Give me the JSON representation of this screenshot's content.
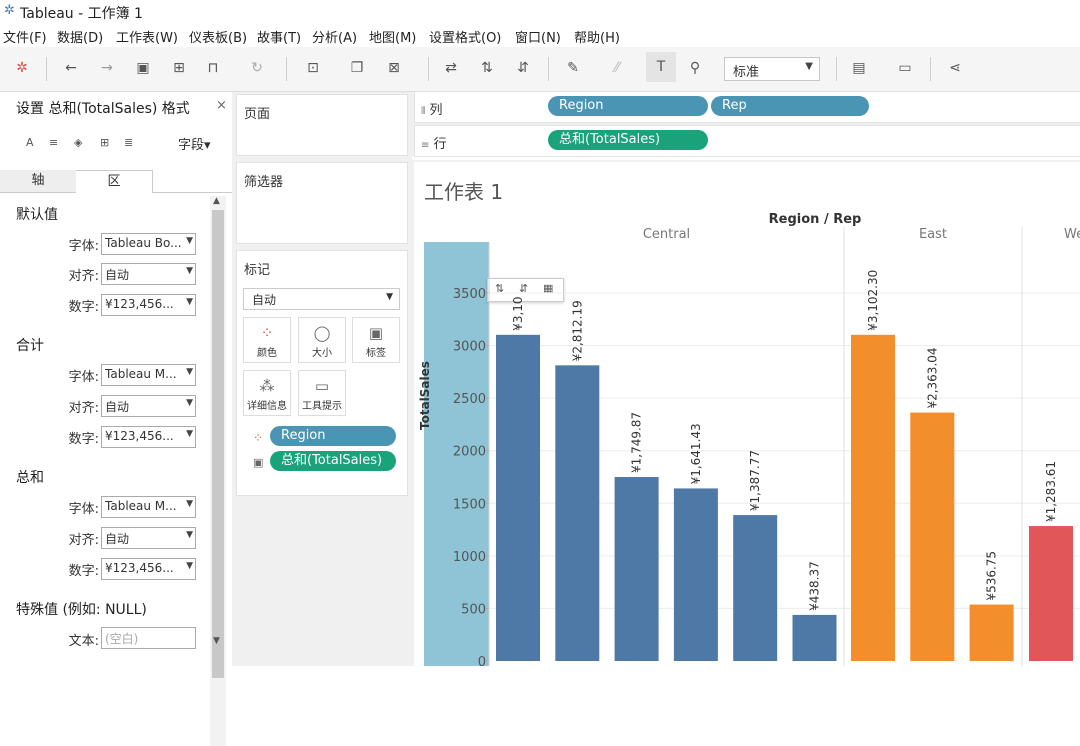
{
  "window": {
    "title": "Tableau - 工作簿 1"
  },
  "menu": [
    "文件(F)",
    "数据(D)",
    "工作表(W)",
    "仪表板(B)",
    "故事(T)",
    "分析(A)",
    "地图(M)",
    "设置格式(O)",
    "窗口(N)",
    "帮助(H)"
  ],
  "toolbar": {
    "fit_select": "标准"
  },
  "format_pane": {
    "title": "设置 总和(TotalSales) 格式",
    "close": "×",
    "fields_button": "字段▾",
    "tabs": {
      "axis": "轴",
      "area": "区"
    },
    "sections": [
      {
        "heading": "默认值",
        "font_label": "字体:",
        "font_value": "Tableau Bo...",
        "align_label": "对齐:",
        "align_value": "自动",
        "number_label": "数字:",
        "number_value": "¥123,456..."
      },
      {
        "heading": "合计",
        "font_label": "字体:",
        "font_value": "Tableau M...",
        "align_label": "对齐:",
        "align_value": "自动",
        "number_label": "数字:",
        "number_value": "¥123,456..."
      },
      {
        "heading": "总和",
        "font_label": "字体:",
        "font_value": "Tableau M...",
        "align_label": "对齐:",
        "align_value": "自动",
        "number_label": "数字:",
        "number_value": "¥123,456..."
      }
    ],
    "special": {
      "heading": "特殊值 (例如: NULL)",
      "text_label": "文本:",
      "text_placeholder": "(空白)"
    }
  },
  "cards": {
    "pages": "页面",
    "filters": "筛选器",
    "marks": {
      "title": "标记",
      "type": "自动",
      "buttons": [
        "颜色",
        "大小",
        "标签",
        "详细信息",
        "工具提示"
      ],
      "pills": [
        "Region",
        "总和(TotalSales)"
      ]
    }
  },
  "shelves": {
    "columns": {
      "label": "列",
      "pills": [
        "Region",
        "Rep"
      ]
    },
    "rows": {
      "label": "行",
      "pills": [
        "总和(TotalSales)"
      ]
    }
  },
  "sheet": {
    "title": "工作表 1",
    "header_title": "Region / Rep",
    "regions": [
      "Central",
      "East",
      "We"
    ]
  },
  "chart_data": {
    "type": "bar",
    "ylabel": "TotalSales",
    "ylim": [
      0,
      3700
    ],
    "yticks": [
      0,
      500,
      1000,
      1500,
      2000,
      2500,
      3000,
      3500
    ],
    "series": [
      {
        "name": "Central",
        "color": "#4e79a7",
        "values": [
          3102.3,
          2812.19,
          1749.87,
          1641.43,
          1387.77,
          438.37
        ],
        "labels": [
          "¥3,10",
          "¥2,812.19",
          "¥1,749.87",
          "¥1,641.43",
          "¥1,387.77",
          "¥438.37"
        ]
      },
      {
        "name": "East",
        "color": "#f28e2b",
        "values": [
          3102.3,
          2363.04,
          536.75
        ],
        "labels": [
          "¥3,102.30",
          "¥2,363.04",
          "¥536.75"
        ]
      },
      {
        "name": "We",
        "color": "#e15759",
        "values": [
          1283.61
        ],
        "labels": [
          "¥1,283.61"
        ]
      }
    ]
  }
}
